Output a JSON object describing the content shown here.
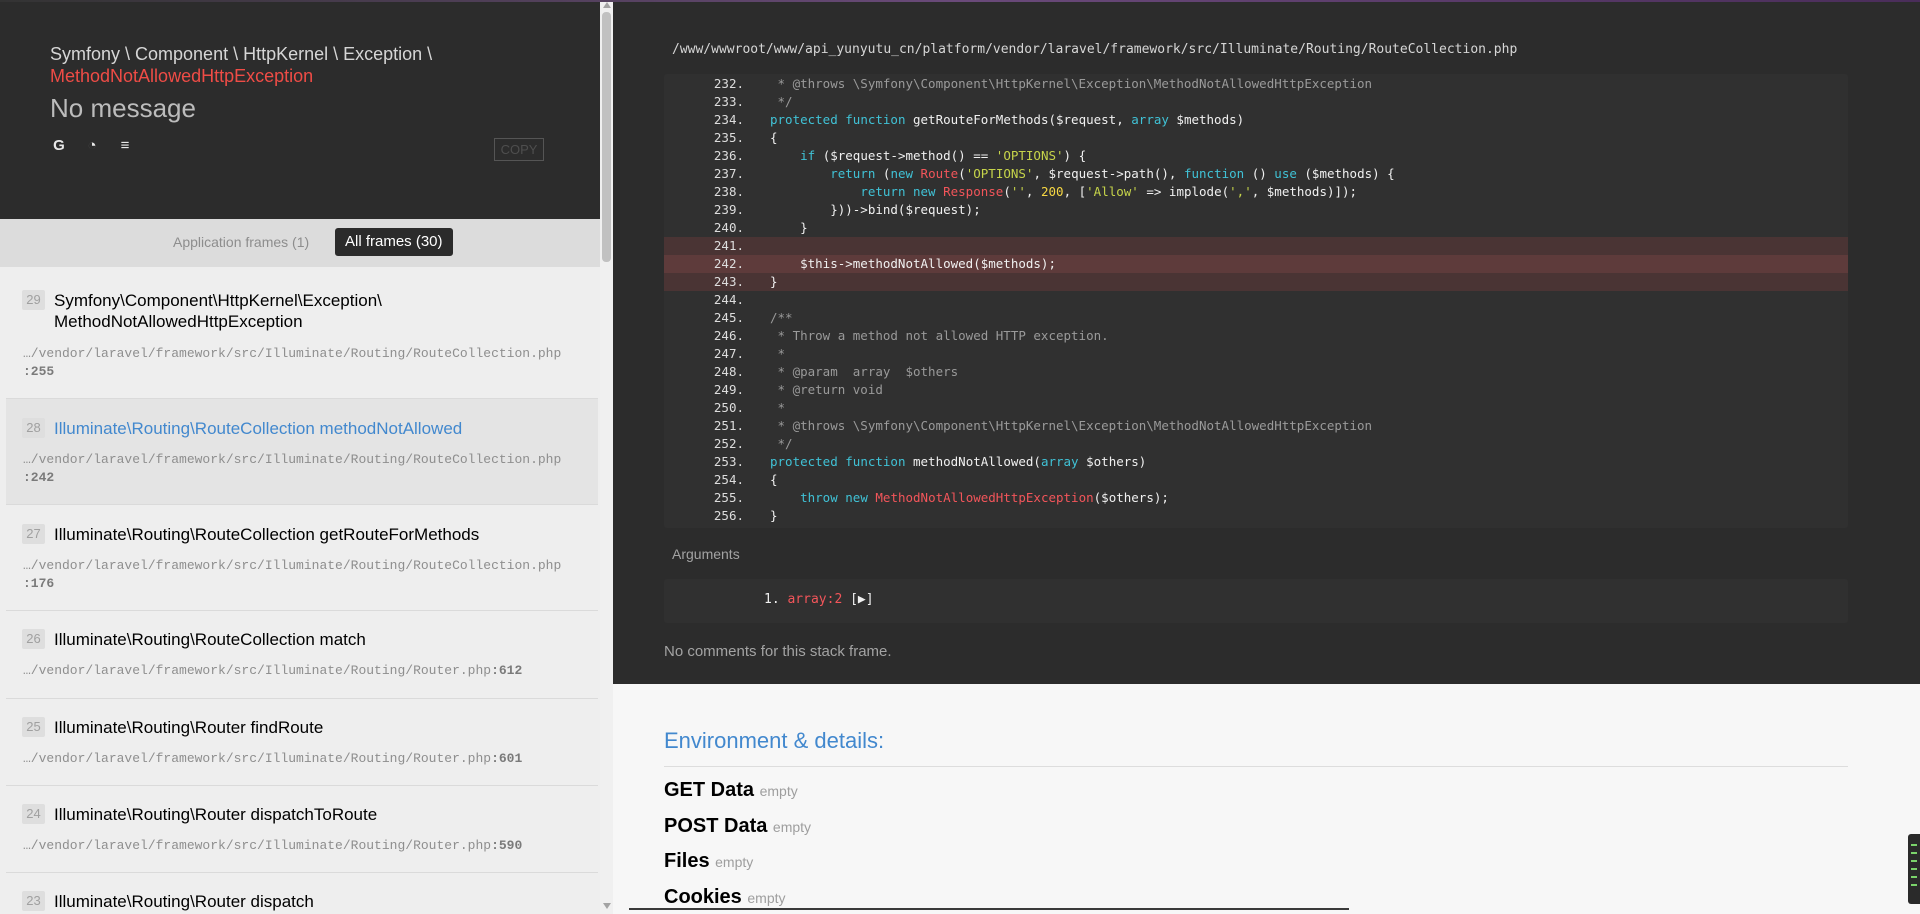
{
  "exception": {
    "namespace": "Symfony \\ Component \\ HttpKernel \\ Exception \\",
    "class": "MethodNotAllowedHttpException",
    "message": "No message",
    "search_links": [
      {
        "icon": "google-icon",
        "glyph": "G"
      },
      {
        "icon": "duckduckgo-icon",
        "glyph": "◔"
      },
      {
        "icon": "stackoverflow-icon",
        "glyph": "≡"
      }
    ],
    "copy_label": "COPY"
  },
  "frame_tabs": {
    "application": "Application frames (1)",
    "all": "All frames (30)"
  },
  "frames": [
    {
      "index": "29",
      "class": "Symfony\\Component\\HttpKernel\\Exception\\ MethodNotAllowedHttpException",
      "file": "…/vendor/laravel/framework/src/Illuminate/Routing/RouteCollection.php",
      "line": ":255"
    },
    {
      "index": "28",
      "class": "Illuminate\\Routing\\RouteCollection methodNotAllowed",
      "file": "…/vendor/laravel/framework/src/Illuminate/Routing/RouteCollection.php",
      "line": ":242"
    },
    {
      "index": "27",
      "class": "Illuminate\\Routing\\RouteCollection getRouteForMethods",
      "file": "…/vendor/laravel/framework/src/Illuminate/Routing/RouteCollection.php",
      "line": ":176"
    },
    {
      "index": "26",
      "class": "Illuminate\\Routing\\RouteCollection match",
      "file": "…/vendor/laravel/framework/src/Illuminate/Routing/Router.php",
      "line": ":612"
    },
    {
      "index": "25",
      "class": "Illuminate\\Routing\\Router findRoute",
      "file": "…/vendor/laravel/framework/src/Illuminate/Routing/Router.php",
      "line": ":601"
    },
    {
      "index": "24",
      "class": "Illuminate\\Routing\\Router dispatchToRoute",
      "file": "…/vendor/laravel/framework/src/Illuminate/Routing/Router.php",
      "line": ":590"
    },
    {
      "index": "23",
      "class": "Illuminate\\Routing\\Router dispatch",
      "file": "",
      "line": ""
    }
  ],
  "code": {
    "file_path": "/www/wwwroot/www/api_yunyutu_cn/platform/vendor/laravel/framework/src/Illuminate/Routing/RouteCollection.php",
    "lines": [
      {
        "n": "232.",
        "t": "     * @throws \\Symfony\\Component\\HttpKernel\\Exception\\MethodNotAllowedHttpException"
      },
      {
        "n": "233.",
        "t": "     */"
      },
      {
        "n": "234.",
        "t": "    protected function getRouteForMethods($request, array $methods)"
      },
      {
        "n": "235.",
        "t": "    {"
      },
      {
        "n": "236.",
        "t": "        if ($request->method() == 'OPTIONS') {"
      },
      {
        "n": "237.",
        "t": "            return (new Route('OPTIONS', $request->path(), function () use ($methods) {"
      },
      {
        "n": "238.",
        "t": "                return new Response('', 200, ['Allow' => implode(',', $methods)]);"
      },
      {
        "n": "239.",
        "t": "            }))->bind($request);"
      },
      {
        "n": "240.",
        "t": "        }"
      },
      {
        "n": "241.",
        "t": ""
      },
      {
        "n": "242.",
        "t": "        $this->methodNotAllowed($methods);"
      },
      {
        "n": "243.",
        "t": "    }"
      },
      {
        "n": "244.",
        "t": ""
      },
      {
        "n": "245.",
        "t": "    /**"
      },
      {
        "n": "246.",
        "t": "     * Throw a method not allowed HTTP exception."
      },
      {
        "n": "247.",
        "t": "     *"
      },
      {
        "n": "248.",
        "t": "     * @param  array  $others"
      },
      {
        "n": "249.",
        "t": "     * @return void"
      },
      {
        "n": "250.",
        "t": "     *"
      },
      {
        "n": "251.",
        "t": "     * @throws \\Symfony\\Component\\HttpKernel\\Exception\\MethodNotAllowedHttpException"
      },
      {
        "n": "252.",
        "t": "     */"
      },
      {
        "n": "253.",
        "t": "    protected function methodNotAllowed(array $others)"
      },
      {
        "n": "254.",
        "t": "    {"
      },
      {
        "n": "255.",
        "t": "        throw new MethodNotAllowedHttpException($others);"
      },
      {
        "n": "256.",
        "t": "    }"
      }
    ]
  },
  "arguments": {
    "label": "Arguments",
    "item_num": "1.",
    "item_type": "array:2",
    "item_rest": " [▶]"
  },
  "no_comments": "No comments for this stack frame.",
  "details": {
    "title": "Environment & details:",
    "rows": [
      {
        "name": "GET Data",
        "value": "empty"
      },
      {
        "name": "POST Data",
        "value": "empty"
      },
      {
        "name": "Files",
        "value": "empty"
      },
      {
        "name": "Cookies",
        "value": "empty"
      }
    ]
  },
  "colors": {
    "exception_red": "#ef4c46",
    "link_blue": "#4288ce",
    "dark_bg": "#2c2c2c"
  }
}
